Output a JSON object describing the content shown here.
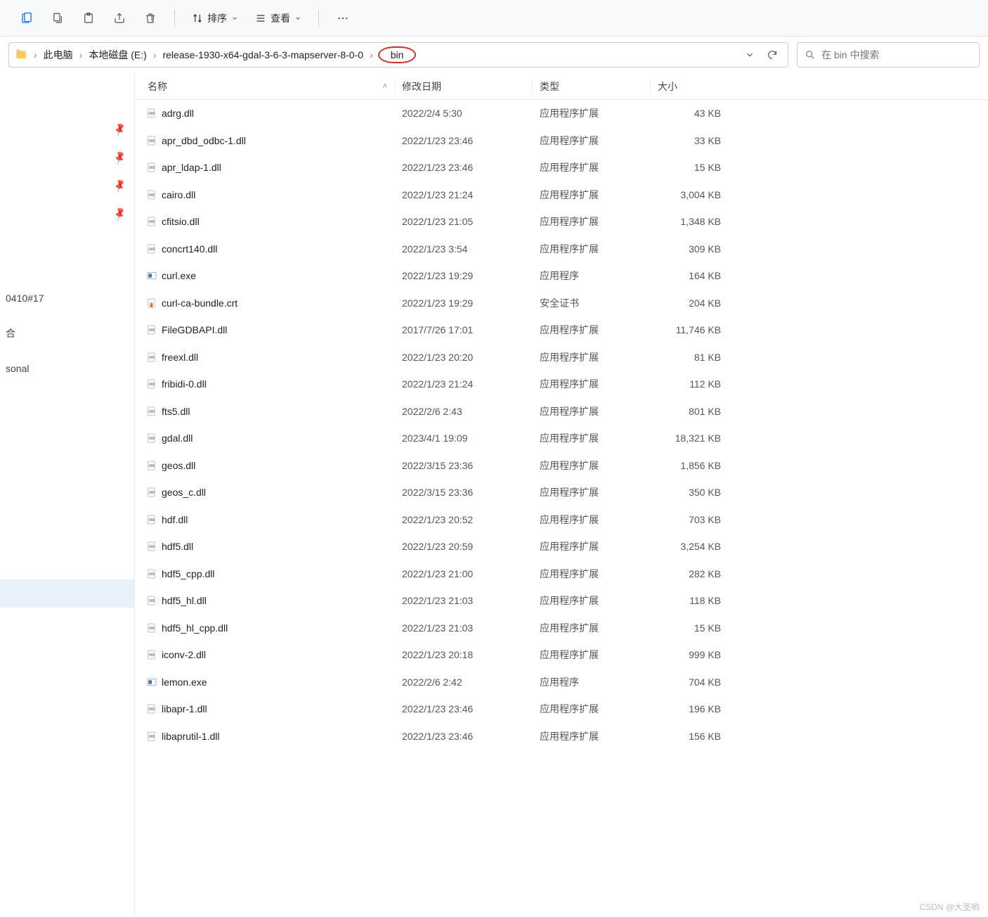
{
  "toolbar": {
    "sort_label": "排序",
    "view_label": "查看"
  },
  "breadcrumb": {
    "segments": [
      "此电脑",
      "本地磁盘 (E:)",
      "release-1930-x64-gdal-3-6-3-mapserver-8-0-0",
      "bin"
    ]
  },
  "search": {
    "placeholder": "在 bin 中搜索"
  },
  "columns": {
    "name": "名称",
    "date": "修改日期",
    "type": "类型",
    "size": "大小"
  },
  "sidebar": {
    "items_trunc": [
      "0410#17",
      "合",
      "sonal"
    ]
  },
  "file_types": {
    "ext": "应用程序扩展",
    "exe": "应用程序",
    "cert": "安全证书"
  },
  "files": [
    {
      "name": "adrg.dll",
      "date": "2022/2/4 5:30",
      "type": "ext",
      "size": "43 KB",
      "icon": "dll"
    },
    {
      "name": "apr_dbd_odbc-1.dll",
      "date": "2022/1/23 23:46",
      "type": "ext",
      "size": "33 KB",
      "icon": "dll"
    },
    {
      "name": "apr_ldap-1.dll",
      "date": "2022/1/23 23:46",
      "type": "ext",
      "size": "15 KB",
      "icon": "dll"
    },
    {
      "name": "cairo.dll",
      "date": "2022/1/23 21:24",
      "type": "ext",
      "size": "3,004 KB",
      "icon": "dll"
    },
    {
      "name": "cfitsio.dll",
      "date": "2022/1/23 21:05",
      "type": "ext",
      "size": "1,348 KB",
      "icon": "dll"
    },
    {
      "name": "concrt140.dll",
      "date": "2022/1/23 3:54",
      "type": "ext",
      "size": "309 KB",
      "icon": "dll"
    },
    {
      "name": "curl.exe",
      "date": "2022/1/23 19:29",
      "type": "exe",
      "size": "164 KB",
      "icon": "exe"
    },
    {
      "name": "curl-ca-bundle.crt",
      "date": "2022/1/23 19:29",
      "type": "cert",
      "size": "204 KB",
      "icon": "cert"
    },
    {
      "name": "FileGDBAPI.dll",
      "date": "2017/7/26 17:01",
      "type": "ext",
      "size": "11,746 KB",
      "icon": "dll"
    },
    {
      "name": "freexl.dll",
      "date": "2022/1/23 20:20",
      "type": "ext",
      "size": "81 KB",
      "icon": "dll"
    },
    {
      "name": "fribidi-0.dll",
      "date": "2022/1/23 21:24",
      "type": "ext",
      "size": "112 KB",
      "icon": "dll"
    },
    {
      "name": "fts5.dll",
      "date": "2022/2/6 2:43",
      "type": "ext",
      "size": "801 KB",
      "icon": "dll"
    },
    {
      "name": "gdal.dll",
      "date": "2023/4/1 19:09",
      "type": "ext",
      "size": "18,321 KB",
      "icon": "dll"
    },
    {
      "name": "geos.dll",
      "date": "2022/3/15 23:36",
      "type": "ext",
      "size": "1,856 KB",
      "icon": "dll"
    },
    {
      "name": "geos_c.dll",
      "date": "2022/3/15 23:36",
      "type": "ext",
      "size": "350 KB",
      "icon": "dll"
    },
    {
      "name": "hdf.dll",
      "date": "2022/1/23 20:52",
      "type": "ext",
      "size": "703 KB",
      "icon": "dll"
    },
    {
      "name": "hdf5.dll",
      "date": "2022/1/23 20:59",
      "type": "ext",
      "size": "3,254 KB",
      "icon": "dll"
    },
    {
      "name": "hdf5_cpp.dll",
      "date": "2022/1/23 21:00",
      "type": "ext",
      "size": "282 KB",
      "icon": "dll"
    },
    {
      "name": "hdf5_hl.dll",
      "date": "2022/1/23 21:03",
      "type": "ext",
      "size": "118 KB",
      "icon": "dll"
    },
    {
      "name": "hdf5_hl_cpp.dll",
      "date": "2022/1/23 21:03",
      "type": "ext",
      "size": "15 KB",
      "icon": "dll"
    },
    {
      "name": "iconv-2.dll",
      "date": "2022/1/23 20:18",
      "type": "ext",
      "size": "999 KB",
      "icon": "dll"
    },
    {
      "name": "lemon.exe",
      "date": "2022/2/6 2:42",
      "type": "exe",
      "size": "704 KB",
      "icon": "exe"
    },
    {
      "name": "libapr-1.dll",
      "date": "2022/1/23 23:46",
      "type": "ext",
      "size": "196 KB",
      "icon": "dll"
    },
    {
      "name": "libaprutil-1.dll",
      "date": "2022/1/23 23:46",
      "type": "ext",
      "size": "156 KB",
      "icon": "dll"
    }
  ],
  "watermark": "CSDN @大圣哟"
}
